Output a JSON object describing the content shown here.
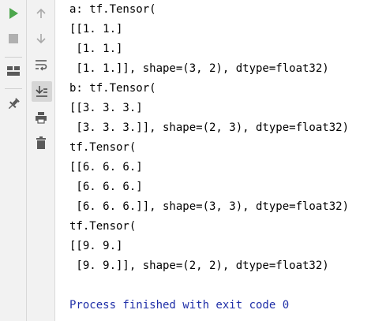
{
  "toolbar": {
    "left": [
      {
        "icon": "run-icon",
        "color": "#4ca64c"
      },
      {
        "icon": "stop-icon",
        "color": "#b0b0b0"
      },
      {
        "icon": "layout-icon",
        "color": "#5a5a5a"
      },
      {
        "icon": "pin-icon",
        "color": "#5a5a5a"
      }
    ],
    "right": [
      {
        "icon": "arrow-up-icon"
      },
      {
        "icon": "arrow-down-icon"
      },
      {
        "icon": "soft-wrap-icon"
      },
      {
        "icon": "scroll-to-end-icon",
        "active": true
      },
      {
        "icon": "print-icon"
      },
      {
        "icon": "trash-icon"
      }
    ]
  },
  "console": {
    "lines": [
      "a: tf.Tensor(",
      "[[1. 1.]",
      " [1. 1.]",
      " [1. 1.]], shape=(3, 2), dtype=float32)",
      "b: tf.Tensor(",
      "[[3. 3. 3.]",
      " [3. 3. 3.]], shape=(2, 3), dtype=float32)",
      "tf.Tensor(",
      "[[6. 6. 6.]",
      " [6. 6. 6.]",
      " [6. 6. 6.]], shape=(3, 3), dtype=float32)",
      "tf.Tensor(",
      "[[9. 9.]",
      " [9. 9.]], shape=(2, 2), dtype=float32)",
      "",
      "Process finished with exit code 0"
    ],
    "exit_color": "#1f2fa8"
  }
}
